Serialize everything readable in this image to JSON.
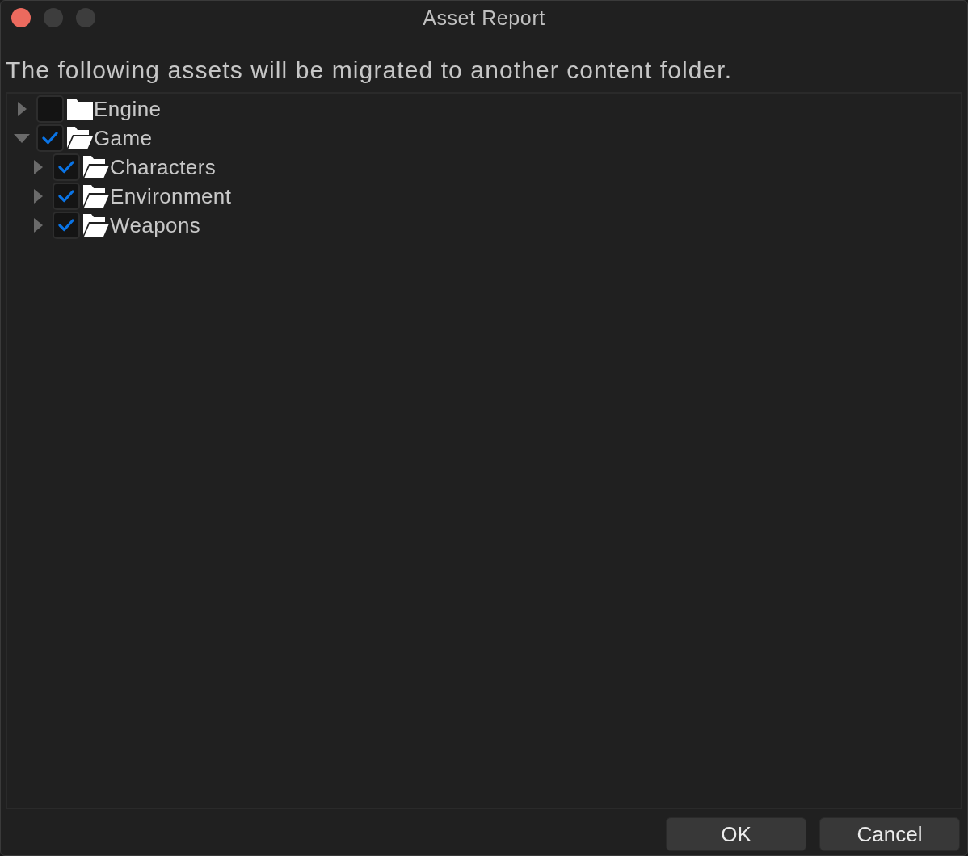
{
  "window": {
    "title": "Asset Report"
  },
  "message": "The following assets will be migrated to another content folder.",
  "tree": [
    {
      "label": "Engine",
      "expanded": false,
      "checked": false,
      "folder_open": false
    },
    {
      "label": "Game",
      "expanded": true,
      "checked": true,
      "folder_open": true,
      "children": [
        {
          "label": "Characters",
          "expanded": false,
          "checked": true,
          "folder_open": true
        },
        {
          "label": "Environment",
          "expanded": false,
          "checked": true,
          "folder_open": true
        },
        {
          "label": "Weapons",
          "expanded": false,
          "checked": true,
          "folder_open": true
        }
      ]
    }
  ],
  "buttons": [
    "OK",
    "Cancel"
  ]
}
